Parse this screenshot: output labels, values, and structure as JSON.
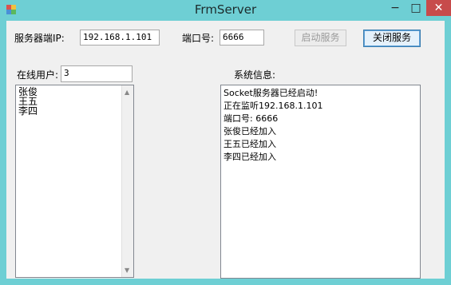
{
  "window": {
    "title": "FrmServer"
  },
  "controls": {
    "minimize": "−",
    "maximize": "□",
    "close": "✕"
  },
  "server": {
    "ip_label": "服务器端IP:",
    "ip_value": "192.168.1.101",
    "port_label": "端口号:",
    "port_value": "6666",
    "start_button": "启动服务",
    "stop_button": "关闭服务"
  },
  "users": {
    "label": "在线用户:",
    "count": "3",
    "list": [
      "张俊",
      "王五",
      "李四"
    ]
  },
  "log": {
    "label": "系统信息:",
    "lines": [
      "Socket服务器已经启动!",
      "正在监听192.168.1.101",
      "端口号: 6666",
      "张俊已经加入",
      "王五已经加入",
      "李四已经加入"
    ]
  },
  "icons": {
    "app": "app-icon",
    "scroll_up": "chevron-up-icon",
    "scroll_down": "chevron-down-icon"
  }
}
